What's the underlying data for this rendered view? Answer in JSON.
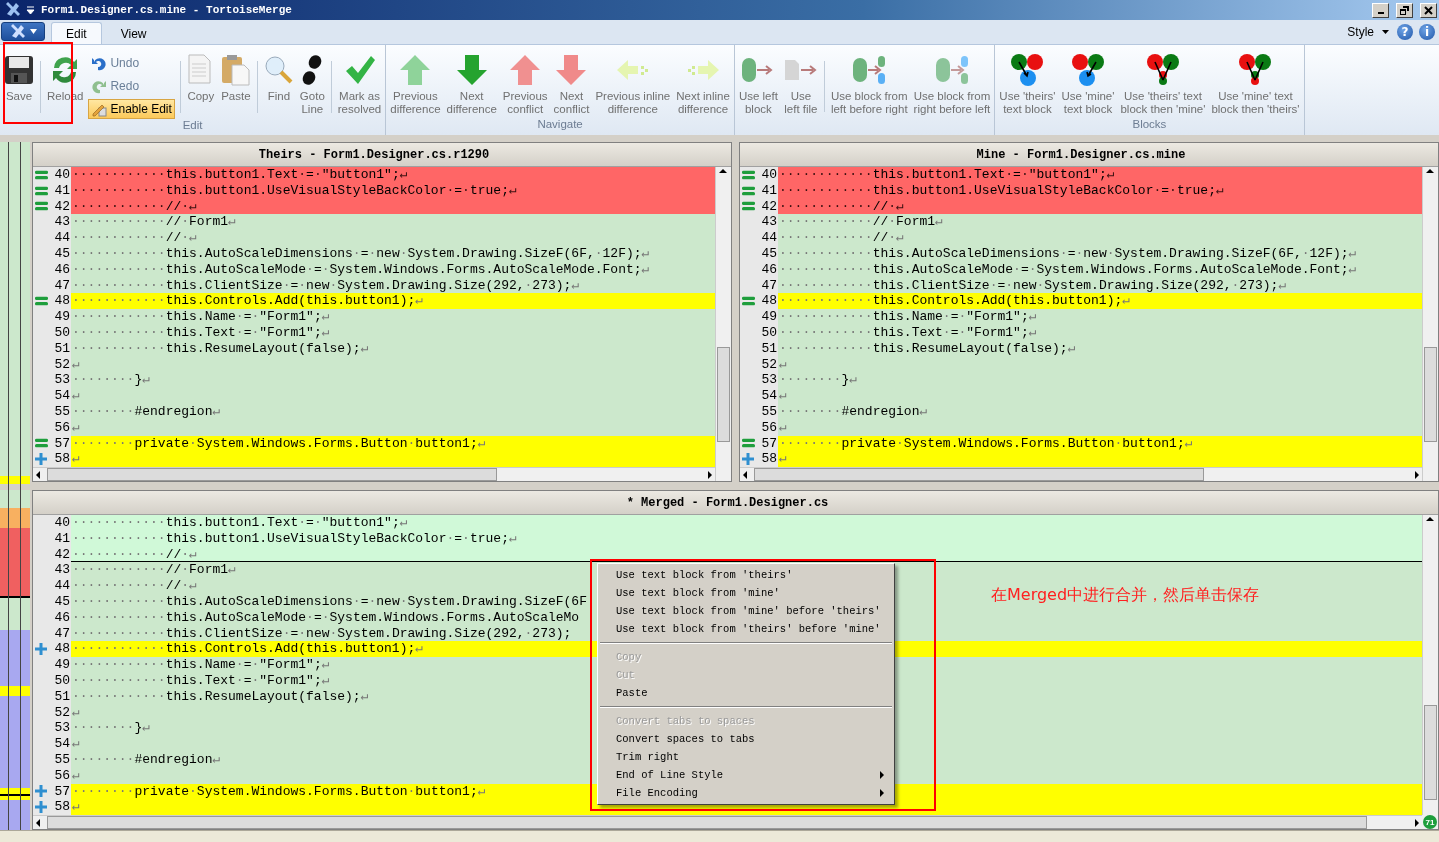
{
  "window": {
    "title": "Form1.Designer.cs.mine - TortoiseMerge"
  },
  "ribbon_tabs": [
    {
      "label": "Edit",
      "selected": true
    },
    {
      "label": "View",
      "selected": false
    }
  ],
  "style_menu": {
    "label": "Style"
  },
  "help_button": "?",
  "about_button": "i",
  "ribbon_groups": [
    {
      "label": "Edit",
      "sets": [
        [
          {
            "kind": "large",
            "label": "Save"
          }
        ],
        [
          {
            "kind": "large",
            "label": "Reload"
          },
          {
            "kind": "small",
            "label": "Undo"
          },
          {
            "kind": "small",
            "label": "Redo"
          },
          {
            "kind": "toggle",
            "label": "Enable Edit",
            "checked": true
          }
        ],
        [
          {
            "kind": "large",
            "label": "Copy"
          },
          {
            "kind": "large",
            "label": "Paste"
          }
        ],
        [
          {
            "kind": "large",
            "label": "Find"
          },
          {
            "kind": "large",
            "label": "Goto\nLine"
          }
        ],
        [
          {
            "kind": "large",
            "label": "Mark as\nresolved"
          }
        ]
      ]
    },
    {
      "label": "Navigate",
      "sets": [
        [
          {
            "kind": "large",
            "label": "Previous\ndifference"
          },
          {
            "kind": "large",
            "label": "Next\ndifference"
          },
          {
            "kind": "large",
            "label": "Previous\nconflict"
          },
          {
            "kind": "large",
            "label": "Next\nconflict"
          },
          {
            "kind": "large",
            "label": "Previous inline\ndifference"
          },
          {
            "kind": "large",
            "label": "Next inline\ndifference"
          }
        ]
      ]
    },
    {
      "sets": [
        [
          {
            "kind": "large",
            "label": "Use left\nblock"
          },
          {
            "kind": "large",
            "label": "Use\nleft file"
          }
        ],
        [
          {
            "kind": "large",
            "label": "Use block from\nleft before right"
          },
          {
            "kind": "large",
            "label": "Use block from\nright before left"
          }
        ]
      ]
    },
    {
      "label": "Blocks",
      "sets": [
        [
          {
            "kind": "large",
            "label": "Use 'theirs'\ntext block"
          },
          {
            "kind": "large",
            "label": "Use 'mine'\ntext block"
          },
          {
            "kind": "large",
            "label": "Use 'theirs' text\nblock then 'mine'"
          },
          {
            "kind": "large",
            "label": "Use 'mine' text\nblock then 'theirs'"
          }
        ]
      ]
    }
  ],
  "theirs_pane": {
    "title": "Theirs - Form1.Designer.cs.r1290",
    "lines": [
      {
        "number": "40",
        "text": "············this.button1.Text·=·\"button1\";↵",
        "kind": "conflict",
        "marker": {
          "kind": "equal"
        }
      },
      {
        "number": "41",
        "text": "············this.button1.UseVisualStyleBackColor·=·true;↵",
        "kind": "conflict",
        "marker": {
          "kind": "equal"
        }
      },
      {
        "number": "42",
        "text": "············//·↵",
        "kind": "conflict",
        "marker": {
          "kind": "equal"
        }
      },
      {
        "number": "43",
        "text": "············//·Form1↵",
        "kind": "same"
      },
      {
        "number": "44",
        "text": "············//·↵",
        "kind": "same"
      },
      {
        "number": "45",
        "text": "············this.AutoScaleDimensions·=·new·System.Drawing.SizeF(6F,·12F);↵",
        "kind": "same"
      },
      {
        "number": "46",
        "text": "············this.AutoScaleMode·=·System.Windows.Forms.AutoScaleMode.Font;↵",
        "kind": "same"
      },
      {
        "number": "47",
        "text": "············this.ClientSize·=·new·System.Drawing.Size(292,·273);↵",
        "kind": "same"
      },
      {
        "number": "48",
        "text": "············this.Controls.Add(this.button1);↵",
        "kind": "changed",
        "marker": {
          "kind": "equal"
        }
      },
      {
        "number": "49",
        "text": "············this.Name·=·\"Form1\";↵",
        "kind": "same"
      },
      {
        "number": "50",
        "text": "············this.Text·=·\"Form1\";↵",
        "kind": "same"
      },
      {
        "number": "51",
        "text": "············this.ResumeLayout(false);↵",
        "kind": "same"
      },
      {
        "number": "52",
        "text": "↵",
        "kind": "same"
      },
      {
        "number": "53",
        "text": "········}↵",
        "kind": "same"
      },
      {
        "number": "54",
        "text": "↵",
        "kind": "same"
      },
      {
        "number": "55",
        "text": "········#endregion↵",
        "kind": "same"
      },
      {
        "number": "56",
        "text": "↵",
        "kind": "same"
      },
      {
        "number": "57",
        "text": "········private·System.Windows.Forms.Button·button1;↵",
        "kind": "changed",
        "marker": {
          "kind": "equal"
        }
      },
      {
        "number": "58",
        "text": "↵",
        "kind": "changed",
        "marker": {
          "kind": "plus"
        }
      }
    ]
  },
  "mine_pane": {
    "title": "Mine - Form1.Designer.cs.mine",
    "lines": [
      {
        "number": "40",
        "text": "············this.button1.Text·=·\"button1\";↵",
        "kind": "conflict",
        "marker": {
          "kind": "equal"
        }
      },
      {
        "number": "41",
        "text": "············this.button1.UseVisualStyleBackColor·=·true;↵",
        "kind": "conflict",
        "marker": {
          "kind": "equal"
        }
      },
      {
        "number": "42",
        "text": "············//·↵",
        "kind": "conflict",
        "marker": {
          "kind": "equal"
        }
      },
      {
        "number": "43",
        "text": "············//·Form1↵",
        "kind": "same"
      },
      {
        "number": "44",
        "text": "············//·↵",
        "kind": "same"
      },
      {
        "number": "45",
        "text": "············this.AutoScaleDimensions·=·new·System.Drawing.SizeF(6F,·12F);↵",
        "kind": "same"
      },
      {
        "number": "46",
        "text": "············this.AutoScaleMode·=·System.Windows.Forms.AutoScaleMode.Font;↵",
        "kind": "same"
      },
      {
        "number": "47",
        "text": "············this.ClientSize·=·new·System.Drawing.Size(292,·273);↵",
        "kind": "same"
      },
      {
        "number": "48",
        "text": "············this.Controls.Add(this.button1);↵",
        "kind": "changed",
        "marker": {
          "kind": "equal"
        }
      },
      {
        "number": "49",
        "text": "············this.Name·=·\"Form1\";↵",
        "kind": "same"
      },
      {
        "number": "50",
        "text": "············this.Text·=·\"Form1\";↵",
        "kind": "same"
      },
      {
        "number": "51",
        "text": "············this.ResumeLayout(false);↵",
        "kind": "same"
      },
      {
        "number": "52",
        "text": "↵",
        "kind": "same"
      },
      {
        "number": "53",
        "text": "········}↵",
        "kind": "same"
      },
      {
        "number": "54",
        "text": "↵",
        "kind": "same"
      },
      {
        "number": "55",
        "text": "········#endregion↵",
        "kind": "same"
      },
      {
        "number": "56",
        "text": "↵",
        "kind": "same"
      },
      {
        "number": "57",
        "text": "········private·System.Windows.Forms.Button·button1;↵",
        "kind": "changed",
        "marker": {
          "kind": "equal"
        }
      },
      {
        "number": "58",
        "text": "↵",
        "kind": "changed",
        "marker": {
          "kind": "plus"
        }
      }
    ]
  },
  "merged_pane": {
    "title": "* Merged - Form1.Designer.cs",
    "lines": [
      {
        "number": "40",
        "text": "············this.button1.Text·=·\"button1\";↵",
        "kind": "resolved"
      },
      {
        "number": "41",
        "text": "············this.button1.UseVisualStyleBackColor·=·true;↵",
        "kind": "resolved"
      },
      {
        "number": "42",
        "text": "············//·↵",
        "kind": "resolved"
      },
      {
        "number": "43",
        "text": "············//·Form1↵",
        "kind": "same"
      },
      {
        "number": "44",
        "text": "············//·↵",
        "kind": "same"
      },
      {
        "number": "45",
        "text": "············this.AutoScaleDimensions·=·new·System.Drawing.SizeF(6F",
        "kind": "same"
      },
      {
        "number": "46",
        "text": "············this.AutoScaleMode·=·System.Windows.Forms.AutoScaleMo",
        "kind": "same"
      },
      {
        "number": "47",
        "text": "············this.ClientSize·=·new·System.Drawing.Size(292,·273);",
        "kind": "same"
      },
      {
        "number": "48",
        "text": "············this.Controls.Add(this.button1);↵",
        "kind": "changed",
        "marker": {
          "kind": "plus"
        }
      },
      {
        "number": "49",
        "text": "············this.Name·=·\"Form1\";↵",
        "kind": "same"
      },
      {
        "number": "50",
        "text": "············this.Text·=·\"Form1\";↵",
        "kind": "same"
      },
      {
        "number": "51",
        "text": "············this.ResumeLayout(false);↵",
        "kind": "same"
      },
      {
        "number": "52",
        "text": "↵",
        "kind": "same"
      },
      {
        "number": "53",
        "text": "········}↵",
        "kind": "same"
      },
      {
        "number": "54",
        "text": "↵",
        "kind": "same"
      },
      {
        "number": "55",
        "text": "········#endregion↵",
        "kind": "same"
      },
      {
        "number": "56",
        "text": "↵",
        "kind": "same"
      },
      {
        "number": "57",
        "text": "········private·System.Windows.Forms.Button·button1;↵",
        "kind": "changed",
        "marker": {
          "kind": "plus"
        }
      },
      {
        "number": "58",
        "text": "↵",
        "kind": "changed",
        "marker": {
          "kind": "plus"
        }
      }
    ]
  },
  "context_menu": {
    "sections": [
      [
        {
          "label": "Use text block from 'theirs'",
          "disabled": false,
          "submenu": false
        },
        {
          "label": "Use text block from 'mine'",
          "disabled": false,
          "submenu": false
        },
        {
          "label": "Use text block from 'mine' before 'theirs'",
          "disabled": false,
          "submenu": false
        },
        {
          "label": "Use text block from 'theirs' before 'mine'",
          "disabled": false,
          "submenu": false
        }
      ],
      [
        {
          "label": "Copy",
          "disabled": true,
          "submenu": false
        },
        {
          "label": "Cut",
          "disabled": true,
          "submenu": false
        },
        {
          "label": "Paste",
          "disabled": false,
          "submenu": false
        }
      ],
      [
        {
          "label": "Convert tabs to spaces",
          "disabled": true,
          "submenu": false
        },
        {
          "label": "Convert spaces to tabs",
          "disabled": false,
          "submenu": false
        },
        {
          "label": "Trim right",
          "disabled": false,
          "submenu": false
        },
        {
          "label": "End of Line Style",
          "disabled": false,
          "submenu": true
        },
        {
          "label": "File Encoding",
          "disabled": false,
          "submenu": true
        }
      ]
    ]
  },
  "annotation": {
    "text": "在Merged中进行合并，然后单击保存"
  },
  "badge": "71"
}
